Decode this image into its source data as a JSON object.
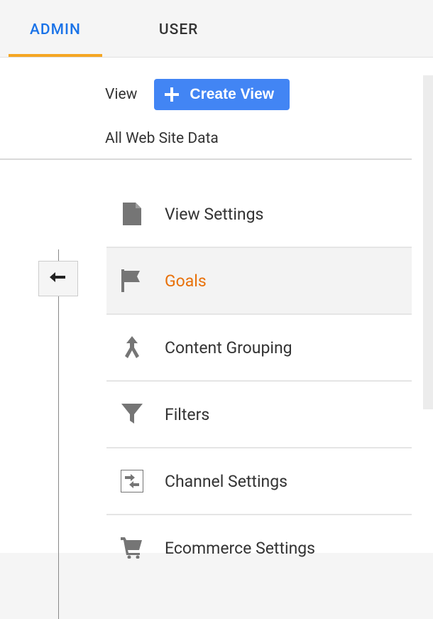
{
  "tabs": {
    "admin": "ADMIN",
    "user": "USER"
  },
  "viewSection": {
    "label": "View",
    "createButton": "Create View",
    "currentView": "All Web Site Data"
  },
  "menu": {
    "items": [
      {
        "label": "View Settings"
      },
      {
        "label": "Goals"
      },
      {
        "label": "Content Grouping"
      },
      {
        "label": "Filters"
      },
      {
        "label": "Channel Settings"
      },
      {
        "label": "Ecommerce Settings"
      }
    ]
  }
}
